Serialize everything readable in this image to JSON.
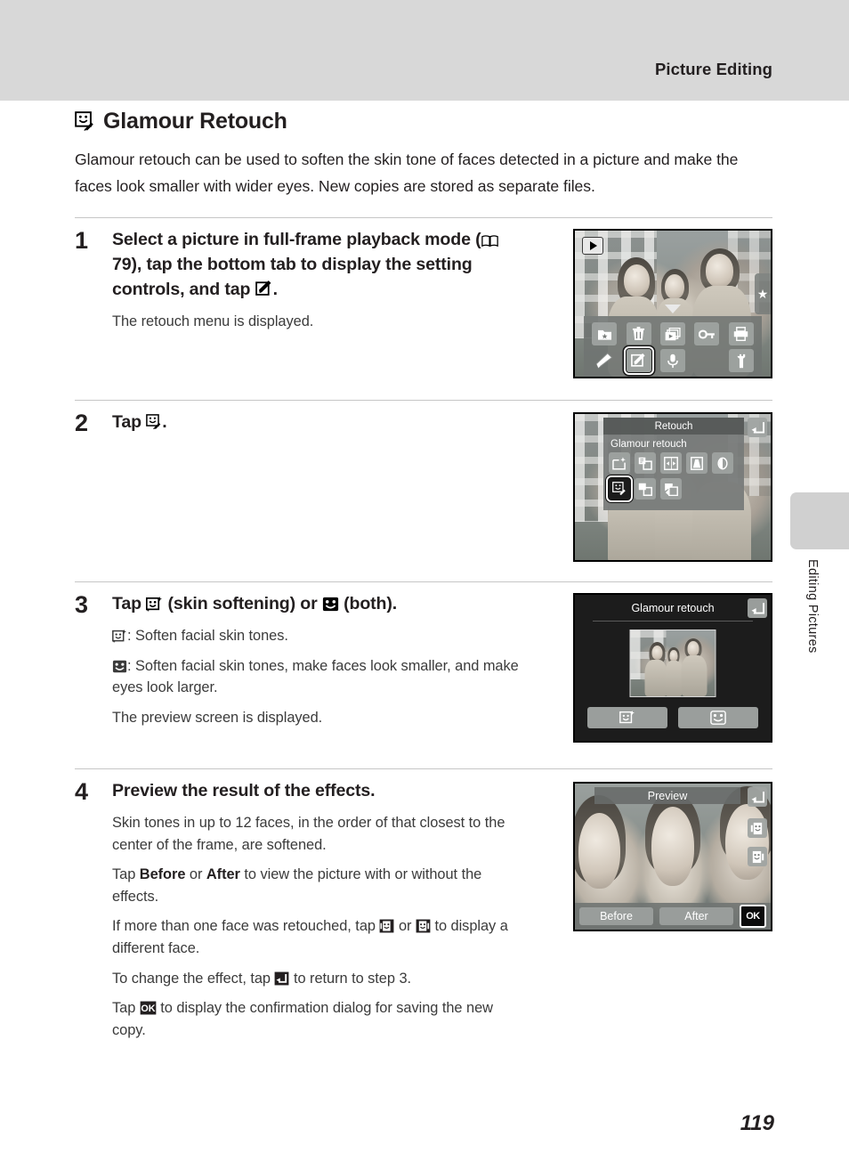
{
  "header": {
    "title": "Picture Editing"
  },
  "side_tab": {
    "label": "Editing Pictures"
  },
  "section": {
    "heading": "Glamour Retouch",
    "heading_icon": "glamour-retouch-icon",
    "intro": "Glamour retouch can be used to soften the skin tone of faces detected in a picture and make the faces look smaller with wider eyes. New copies are stored as separate files."
  },
  "steps": [
    {
      "number": "1",
      "title_part1": "Select a picture in full-frame playback mode (",
      "title_ref": "79",
      "title_part2": "), tap the bottom tab to display the setting controls, and tap ",
      "title_part3": ".",
      "sub": "The retouch menu is displayed."
    },
    {
      "number": "2",
      "title_part1": "Tap ",
      "title_part2": "."
    },
    {
      "number": "3",
      "title_part1": "Tap ",
      "title_part2": " (skin softening) or ",
      "title_part3": " (both).",
      "sub1_text": ": Soften facial skin tones.",
      "sub2_text": ": Soften facial skin tones, make faces look smaller, and make eyes look larger.",
      "sub3": "The preview screen is displayed."
    },
    {
      "number": "4",
      "title": "Preview the result of the effects.",
      "sub1": "Skin tones in up to 12 faces, in the order of that closest to the center of the frame, are softened.",
      "sub2_a": "Tap ",
      "sub2_b": "Before",
      "sub2_c": " or ",
      "sub2_d": "After",
      "sub2_e": " to view the picture with or without the effects.",
      "sub3_a": "If more than one face was retouched, tap ",
      "sub3_b": " or ",
      "sub3_c": " to display a different face.",
      "sub4_a": "To change the effect, tap ",
      "sub4_b": " to return to step 3.",
      "sub5_a": "Tap ",
      "sub5_b": " to display the confirmation dialog for saving the new copy."
    }
  ],
  "screens": {
    "playback": {
      "name": "full-frame-playback-screen",
      "badge_icon": "playback-mode-icon",
      "side_tab_icon": "star-icon",
      "toolbar_row1": [
        "favorites-folder-icon",
        "delete-trash-icon",
        "slideshow-icon",
        "protect-key-icon",
        "print-icon"
      ],
      "toolbar_row2": [
        "draw-pencil-icon",
        "retouch-icon",
        "voice-memo-mic-icon",
        "setup-wrench-icon"
      ],
      "selected": "retouch-icon"
    },
    "retouch_menu": {
      "name": "retouch-menu-screen",
      "title": "Retouch",
      "label": "Glamour retouch",
      "back_icon": "back-arrow-icon",
      "row1_icons": [
        "quick-retouch-icon",
        "d-lighting-icon",
        "small-picture-icon",
        "perspective-control-icon",
        "soft-filter-icon"
      ],
      "row2_icons": [
        "glamour-retouch-icon",
        "crop-icon",
        "rotate-icon"
      ],
      "selected": "glamour-retouch-icon"
    },
    "glamour": {
      "name": "glamour-retouch-screen",
      "title": "Glamour retouch",
      "back_icon": "back-arrow-icon",
      "button_left_icon": "skin-softening-icon",
      "button_right_icon": "both-effects-icon"
    },
    "preview": {
      "name": "preview-screen",
      "title": "Preview",
      "back_icon": "back-arrow-icon",
      "prev_face_icon": "previous-face-icon",
      "next_face_icon": "next-face-icon",
      "before_label": "Before",
      "after_label": "After",
      "ok_label": "OK"
    }
  },
  "footer": {
    "page_number": "119"
  },
  "colors": {
    "header_band": "#d8d8d8",
    "side_tab": "#d0d0d0",
    "text": "#231f20",
    "rule": "#c6c6c6"
  }
}
